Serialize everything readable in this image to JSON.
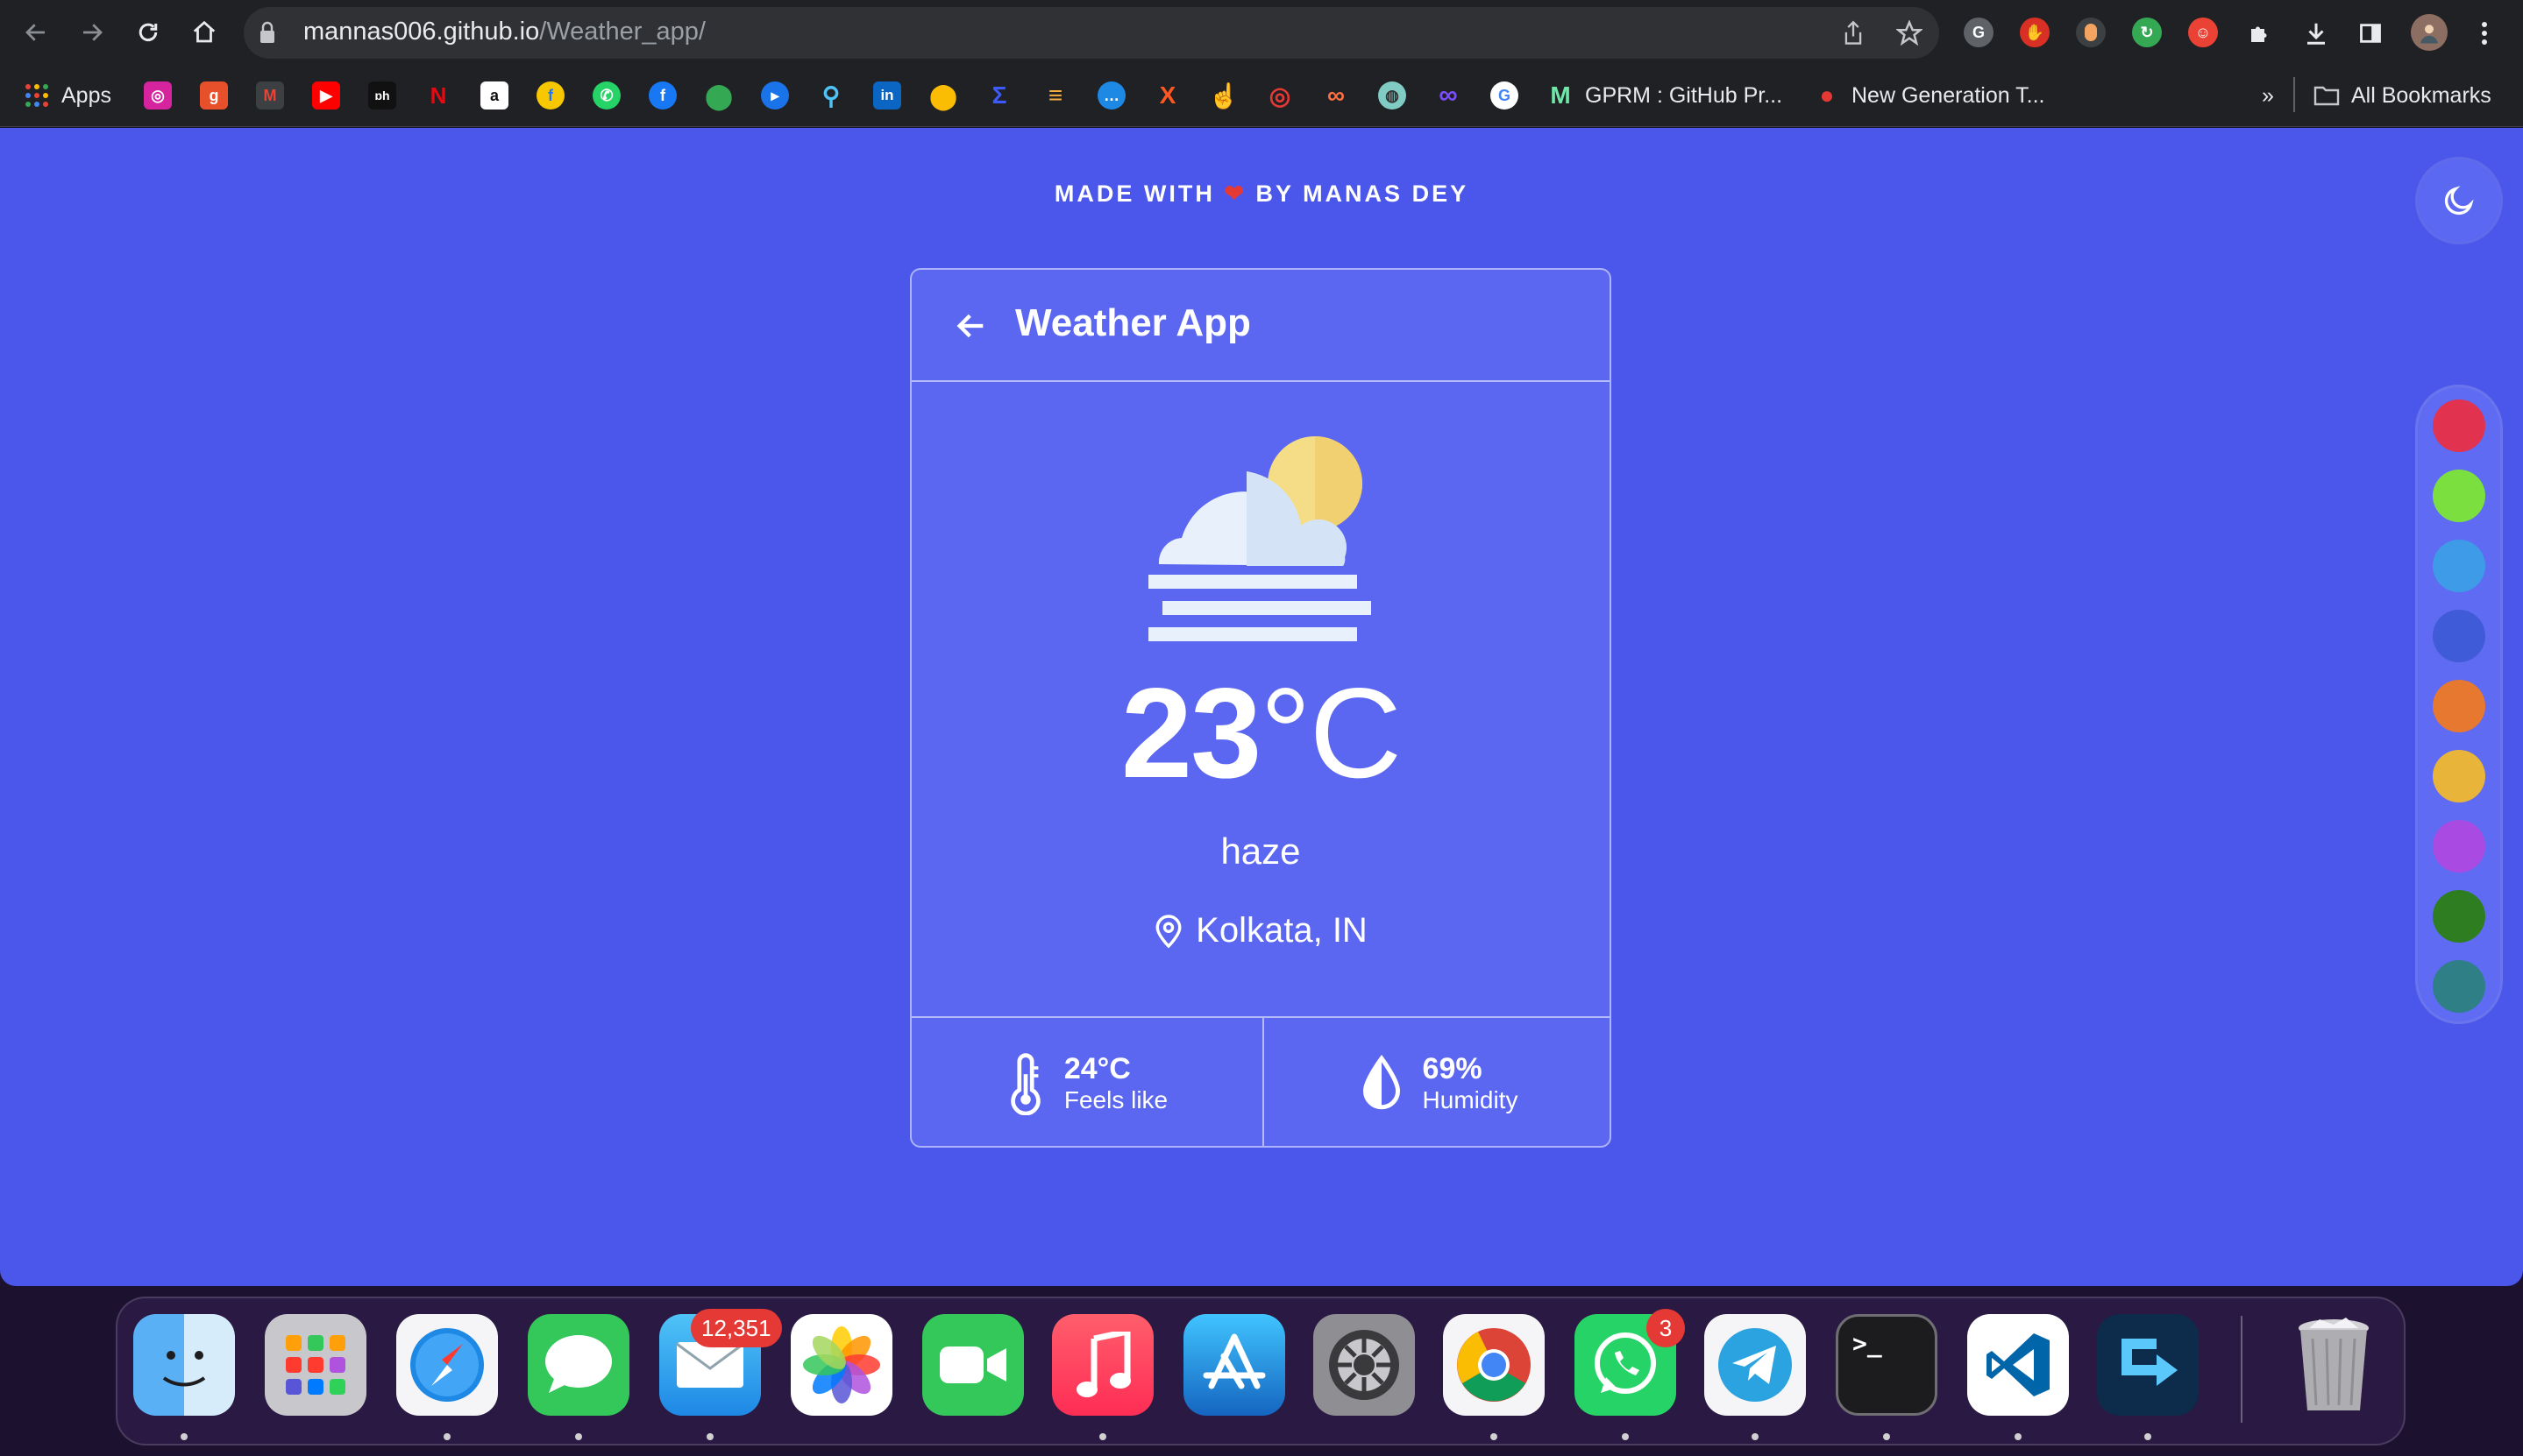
{
  "browser": {
    "url_host": "mannas006.github.io",
    "url_path": "/Weather_app/"
  },
  "bookmarks": {
    "apps_label": "Apps",
    "items": [
      {
        "label": "GPRM : GitHub Pr..."
      },
      {
        "label": "New Generation T..."
      }
    ],
    "overflow": "»",
    "all_bookmarks": "All Bookmarks"
  },
  "page": {
    "credit_prefix": "MADE WITH",
    "credit_heart": "❤",
    "credit_suffix": "BY MANAS DEY"
  },
  "card": {
    "title": "Weather App",
    "temperature": "23",
    "temperature_unit": "°C",
    "description": "haze",
    "location": "Kolkata, IN",
    "feels_like_value": "24°C",
    "feels_like_label": "Feels like",
    "humidity_value": "69%",
    "humidity_label": "Humidity"
  },
  "palette": {
    "colors": [
      "#e1334f",
      "#7be03f",
      "#3e9be8",
      "#3f5bd8",
      "#e6782f",
      "#e9b43a",
      "#a94be3",
      "#2e7d20",
      "#2f7f86"
    ]
  },
  "dock": {
    "mail_badge": "12,351",
    "whatsapp_badge": "3"
  },
  "colors": {
    "page_bg": "#4a57ea",
    "card_bg": "#5b67f0"
  }
}
